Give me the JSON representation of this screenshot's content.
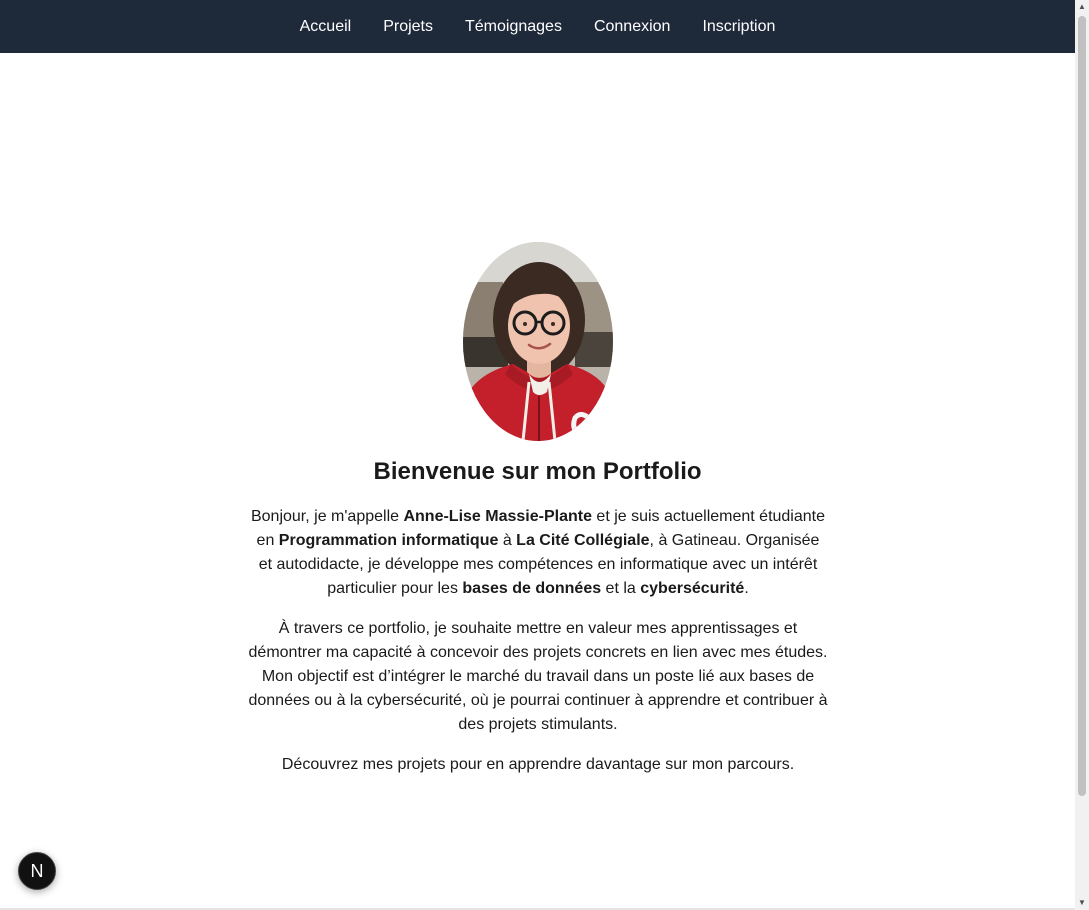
{
  "nav": {
    "items": [
      {
        "label": "Accueil"
      },
      {
        "label": "Projets"
      },
      {
        "label": "Témoignages"
      },
      {
        "label": "Connexion"
      },
      {
        "label": "Inscription"
      }
    ]
  },
  "hero": {
    "title": "Bienvenue sur mon Portfolio",
    "p1": {
      "t1": "Bonjour, je m'appelle ",
      "name": "Anne-Lise Massie-Plante",
      "t2": " et je suis actuellement étudiante en ",
      "program": "Programmation informatique",
      "t3": " à ",
      "school": "La Cité Collégiale",
      "t4": ", à Gatineau. Organisée et autodidacte, je développe mes compétences en informatique avec un intérêt particulier pour les ",
      "topic1": "bases de données",
      "t5": " et la ",
      "topic2": "cybersécurité",
      "t6": "."
    },
    "p2": "À travers ce portfolio, je souhaite mettre en valeur mes apprentissages et démontrer ma capacité à concevoir des projets concrets en lien avec mes études. Mon objectif est d’intégrer le marché du travail dans un poste lié aux bases de données ou à la cybersécurité, où je pourrai continuer à apprendre et contribuer à des projets stimulants.",
    "p3": "Découvrez mes projets pour en apprendre davantage sur mon parcours."
  },
  "badge": {
    "letter": "N"
  },
  "colors": {
    "nav_bg": "#1e2939",
    "nav_text": "#ffffff",
    "text": "#1a1a1a",
    "sweater": "#c4202c"
  }
}
